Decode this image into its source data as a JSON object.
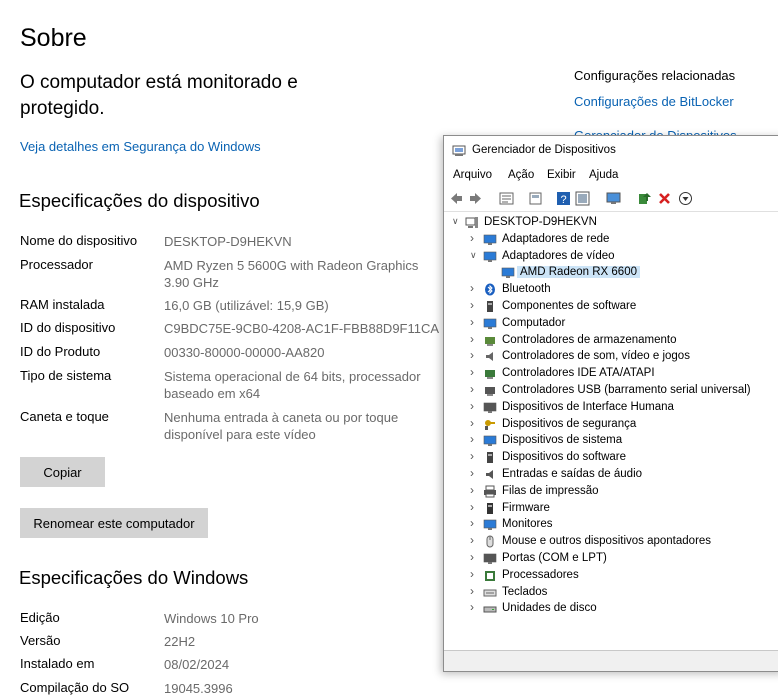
{
  "about": {
    "title": "Sobre",
    "protect_line1": "O computador está monitorado e",
    "protect_line2": "protegido.",
    "security_link": "Veja detalhes em Segurança do Windows"
  },
  "device_specs": {
    "heading": "Especificações do dispositivo",
    "rows": [
      {
        "label": "Nome do dispositivo",
        "value": "DESKTOP-D9HEKVN"
      },
      {
        "label": "Processador",
        "value": "AMD Ryzen 5 5600G with Radeon Graphics",
        "value2": "3.90 GHz"
      },
      {
        "label": "RAM instalada",
        "value": "16,0 GB (utilizável: 15,9 GB)"
      },
      {
        "label": "ID do dispositivo",
        "value": "C9BDC75E-9CB0-4208-AC1F-FBB88D9F11CA"
      },
      {
        "label": "ID do Produto",
        "value": "00330-80000-00000-AA820"
      },
      {
        "label": "Tipo de sistema",
        "value": "Sistema operacional de 64 bits, processador",
        "value2": "baseado em x64"
      },
      {
        "label": "Caneta e toque",
        "value": "Nenhuma entrada à caneta ou por toque",
        "value2": "disponível para este vídeo"
      }
    ],
    "copy_button": "Copiar",
    "rename_button": "Renomear este computador"
  },
  "windows_specs": {
    "heading": "Especificações do Windows",
    "rows": [
      {
        "label": "Edição",
        "value": "Windows 10 Pro"
      },
      {
        "label": "Versão",
        "value": "22H2"
      },
      {
        "label": "Instalado em",
        "value": "08/02/2024"
      },
      {
        "label": "Compilação do SO",
        "value": "19045.3996"
      }
    ]
  },
  "related": {
    "heading": "Configurações relacionadas",
    "bitlocker_link": "Configurações de BitLocker",
    "partial_link": "Gerenciador de Dispositivos"
  },
  "device_manager": {
    "title": "Gerenciador de Dispositivos",
    "menu": [
      "Arquivo",
      "Ação",
      "Exibir",
      "Ajuda"
    ],
    "root": "DESKTOP-D9HEKVN",
    "items": [
      {
        "label": "Adaptadores de rede",
        "icon": "network-adapter-icon",
        "color": "#2b7bd6"
      },
      {
        "label": "Adaptadores de vídeo",
        "icon": "display-adapter-icon",
        "color": "#2b7bd6",
        "expanded": true
      },
      {
        "label": "AMD Radeon RX 6600",
        "icon": "display-adapter-icon",
        "color": "#2b7bd6",
        "child": true,
        "selected": true
      },
      {
        "label": "Bluetooth",
        "icon": "bluetooth-icon",
        "color": "#1a5fc0"
      },
      {
        "label": "Componentes de software",
        "icon": "software-component-icon",
        "color": "#444"
      },
      {
        "label": "Computador",
        "icon": "computer-icon",
        "color": "#2b7bd6"
      },
      {
        "label": "Controladores de armazenamento",
        "icon": "storage-controller-icon",
        "color": "#5a8a3a"
      },
      {
        "label": "Controladores de som, vídeo e jogos",
        "icon": "speaker-icon",
        "color": "#666"
      },
      {
        "label": "Controladores IDE ATA/ATAPI",
        "icon": "ide-controller-icon",
        "color": "#3a7a3a"
      },
      {
        "label": "Controladores USB (barramento serial universal)",
        "icon": "usb-icon",
        "color": "#555"
      },
      {
        "label": "Dispositivos de Interface Humana",
        "icon": "hid-icon",
        "color": "#555"
      },
      {
        "label": "Dispositivos de segurança",
        "icon": "security-device-icon",
        "color": "#c99a00"
      },
      {
        "label": "Dispositivos de sistema",
        "icon": "system-device-icon",
        "color": "#2b7bd6"
      },
      {
        "label": "Dispositivos do software",
        "icon": "software-device-icon",
        "color": "#444"
      },
      {
        "label": "Entradas e saídas de áudio",
        "icon": "audio-io-icon",
        "color": "#555"
      },
      {
        "label": "Filas de impressão",
        "icon": "printer-icon",
        "color": "#555"
      },
      {
        "label": "Firmware",
        "icon": "firmware-icon",
        "color": "#333"
      },
      {
        "label": "Monitores",
        "icon": "monitor-icon",
        "color": "#2b7bd6"
      },
      {
        "label": "Mouse e outros dispositivos apontadores",
        "icon": "mouse-icon",
        "color": "#666"
      },
      {
        "label": "Portas (COM e LPT)",
        "icon": "port-icon",
        "color": "#555"
      },
      {
        "label": "Processadores",
        "icon": "processor-icon",
        "color": "#3a7a3a"
      },
      {
        "label": "Teclados",
        "icon": "keyboard-icon",
        "color": "#666"
      },
      {
        "label": "Unidades de disco",
        "icon": "disk-drive-icon",
        "color": "#555"
      }
    ]
  }
}
